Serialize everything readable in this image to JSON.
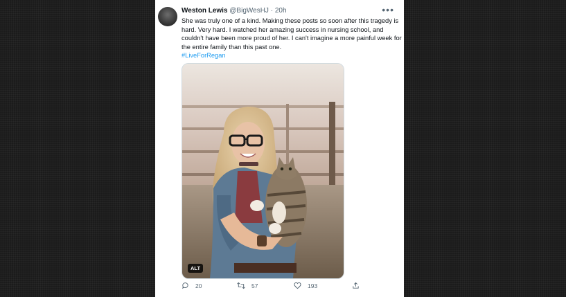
{
  "tweet": {
    "author_name": "Weston Lewis",
    "handle": "@BigWesHJ",
    "separator": "·",
    "time": "20h",
    "text": "She was truly one of a kind. Making these posts so soon after this tragedy is hard. Very hard. I watched her amazing success in nursing school, and couldn't have been more proud of her. I can't imagine a more painful week for the entire family than this past one.",
    "hashtag": "#LiveForRegan",
    "more_icon": "more-horizontal-icon",
    "media": {
      "alt_label": "ALT"
    },
    "actions": {
      "reply_count": "20",
      "retweet_count": "57",
      "like_count": "193"
    }
  },
  "colors": {
    "page_background": "#1b1b1b",
    "card_background": "#ffffff",
    "text_primary": "#0f1419",
    "text_secondary": "#536471",
    "link": "#1d9bf0"
  }
}
